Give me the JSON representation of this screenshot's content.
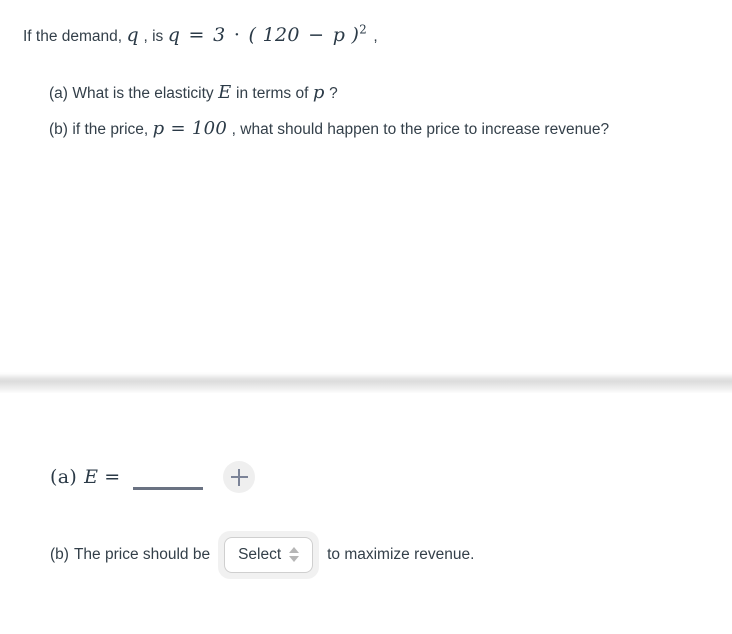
{
  "problem": {
    "stem": {
      "lead": "If the demand,",
      "var_q": "q",
      "comma_1": ", is",
      "equation": {
        "lhs": "q",
        "equals": "=",
        "coefficient": "3",
        "dot": "·",
        "open_paren": "(",
        "constant": "120",
        "minus": "−",
        "var_p": "p",
        "close_paren": ")",
        "exponent": "2"
      },
      "trailing_comma": ","
    },
    "questions": [
      {
        "label": "(a)",
        "text_before": "What is the elasticity",
        "symbol": "E",
        "text_after": "in terms of",
        "symbol_2": "p",
        "question_mark": "?"
      },
      {
        "label": "(b)",
        "text_before": "if the price,",
        "equation": "p = 100",
        "text_after": ", what should happen to the price to increase revenue?"
      }
    ]
  },
  "answers": {
    "part_a": {
      "label": "(a)",
      "symbol": "E",
      "equals": "=",
      "blank_value": "",
      "add_button_icon": "plus-icon"
    },
    "part_b": {
      "label": "(b)",
      "text_before": "The price should be",
      "select": {
        "value": "Select",
        "placeholder": "Select",
        "spinner_icon": "up-down-arrows-icon"
      },
      "text_after": "to maximize revenue."
    }
  },
  "colors": {
    "text": "#333f49",
    "math": "#2b3a47",
    "blank_rule": "#6a7282",
    "plus_icon": "#7b8397",
    "button_bg": "#efefef",
    "select_border": "#cfcfcf",
    "select_wrapper_bg": "#f1f1f1",
    "spinner_arrow": "#b6b6b6",
    "splitter": "#dcdcdc",
    "page_bg": "#ffffff"
  }
}
